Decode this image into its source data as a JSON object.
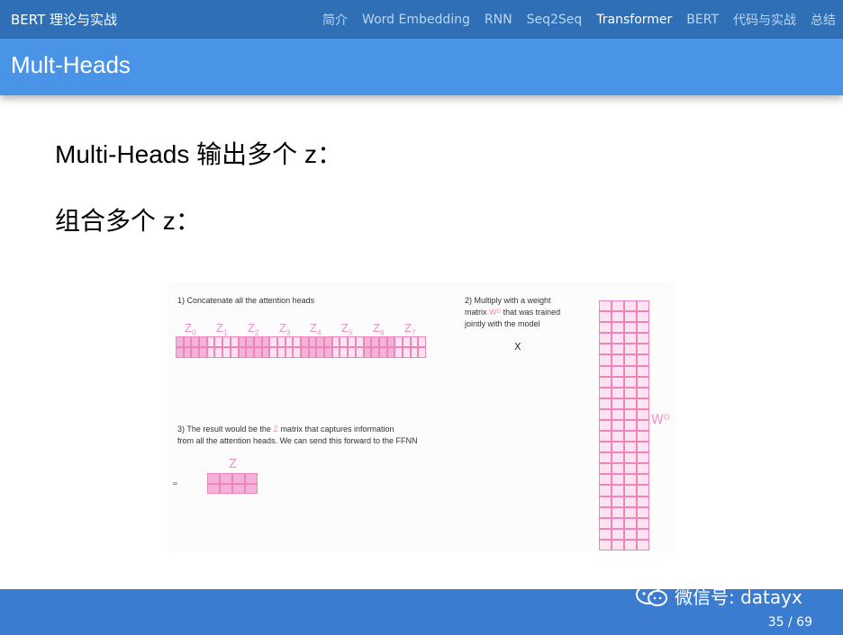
{
  "nav": {
    "brand": "BERT 理论与实战",
    "links": [
      {
        "label": "简介",
        "active": false
      },
      {
        "label": "Word Embedding",
        "active": false
      },
      {
        "label": "RNN",
        "active": false
      },
      {
        "label": "Seq2Seq",
        "active": false
      },
      {
        "label": "Transformer",
        "active": true
      },
      {
        "label": "BERT",
        "active": false
      },
      {
        "label": "代码与实战",
        "active": false
      },
      {
        "label": "总结",
        "active": false
      }
    ]
  },
  "slide": {
    "title": "Mult-Heads",
    "line1": "Multi-Heads 输出多个 z：",
    "line2": "组合多个 z："
  },
  "figure": {
    "step1": "1) Concatenate all the attention heads",
    "step2_a": "2) Multiply with a weight",
    "step2_b": "matrix",
    "step2_wo": "Wᴼ",
    "step2_c": "that was trained",
    "step2_d": "jointly with the model",
    "step3_a": "3) The result would be the",
    "step3_z": "Z",
    "step3_b": "matrix that captures information",
    "step3_c": "from all the attention heads. We can send this forward to the FFNN",
    "z_labels": [
      "0",
      "1",
      "2",
      "3",
      "4",
      "5",
      "6",
      "7"
    ],
    "z_letter": "Z",
    "times": "X",
    "equals": "=",
    "w_label": "Wᴼ",
    "z_result": "Z"
  },
  "footer": {
    "wechat": "微信号: datayx",
    "page": "35 / 69"
  },
  "colors": {
    "navbar": "#2f6fb6",
    "titlebar": "#4a94e8",
    "footer": "#3a7cd0",
    "matrix_pink": "#f08ec4"
  }
}
